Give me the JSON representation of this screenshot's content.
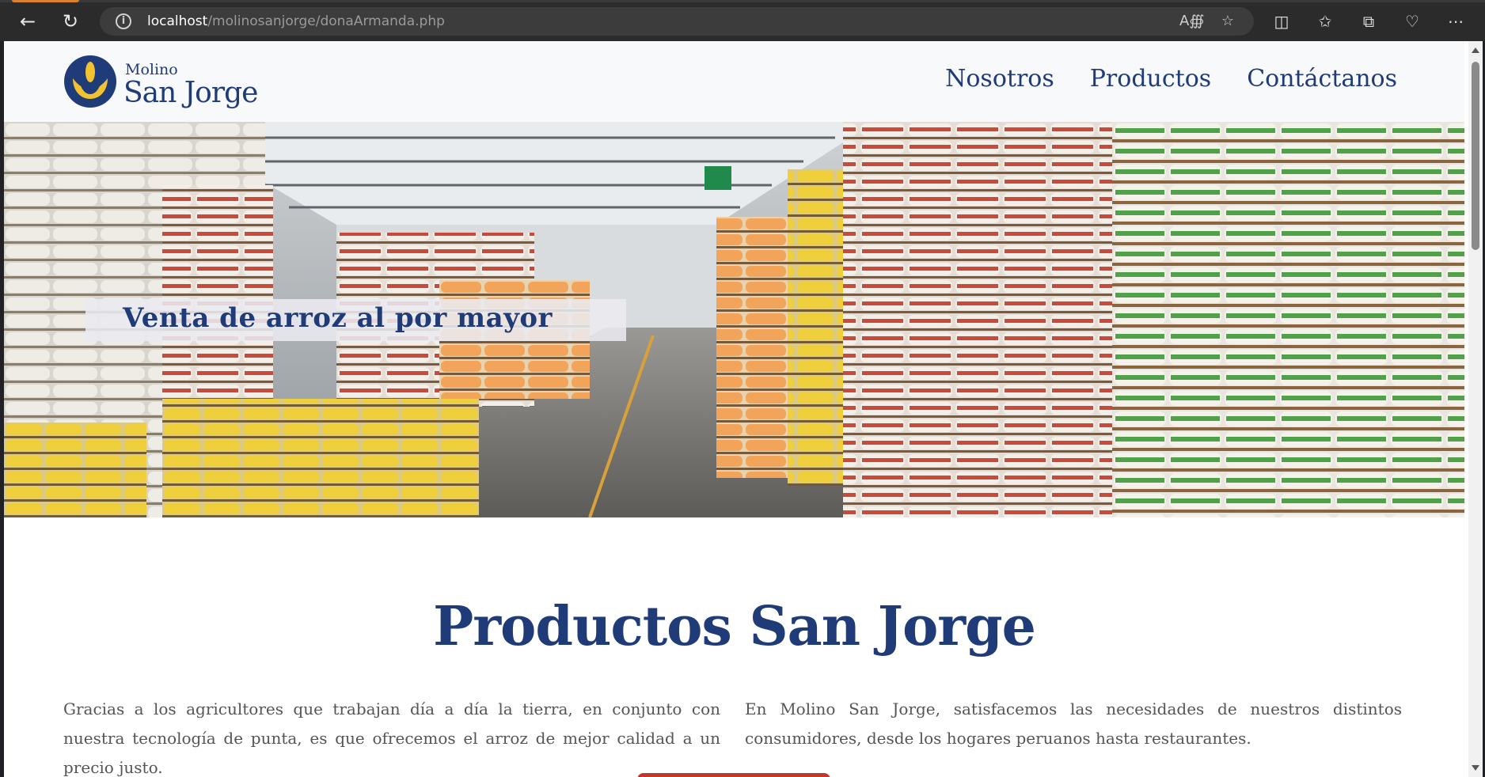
{
  "browser": {
    "url_host": "localhost",
    "url_path": "/molinosanjorge/donaArmanda.php",
    "icons": {
      "back": "back-arrow-icon",
      "reload": "reload-icon",
      "info": "site-info-icon",
      "read_aloud": "read-aloud-icon",
      "favorite": "favorite-star-icon",
      "split": "split-screen-icon",
      "favorites": "favorites-list-icon",
      "collections": "collections-icon",
      "health": "browser-essentials-icon",
      "more": "more-menu-icon"
    }
  },
  "site": {
    "logo": {
      "top": "Molino",
      "main": "San Jorge"
    },
    "nav": [
      "Nosotros",
      "Productos",
      "Contáctanos"
    ],
    "hero_caption": "Venta de arroz al por mayor",
    "section_title": "Productos San Jorge",
    "paragraphs": [
      "Gracias a los agricultores que trabajan día a día la tierra, en conjunto con nuestra tecnología de punta, es que ofrecemos el arroz de mejor calidad a un precio justo.",
      "En Molino San Jorge, satisfacemos las necesidades de nuestros distintos consumidores, desde los hogares peruanos hasta restaurantes."
    ]
  },
  "colors": {
    "brand_blue": "#1f3b78",
    "logo_gold": "#f2c230",
    "text_gray": "#555555",
    "header_bg": "#f8f9fa"
  }
}
